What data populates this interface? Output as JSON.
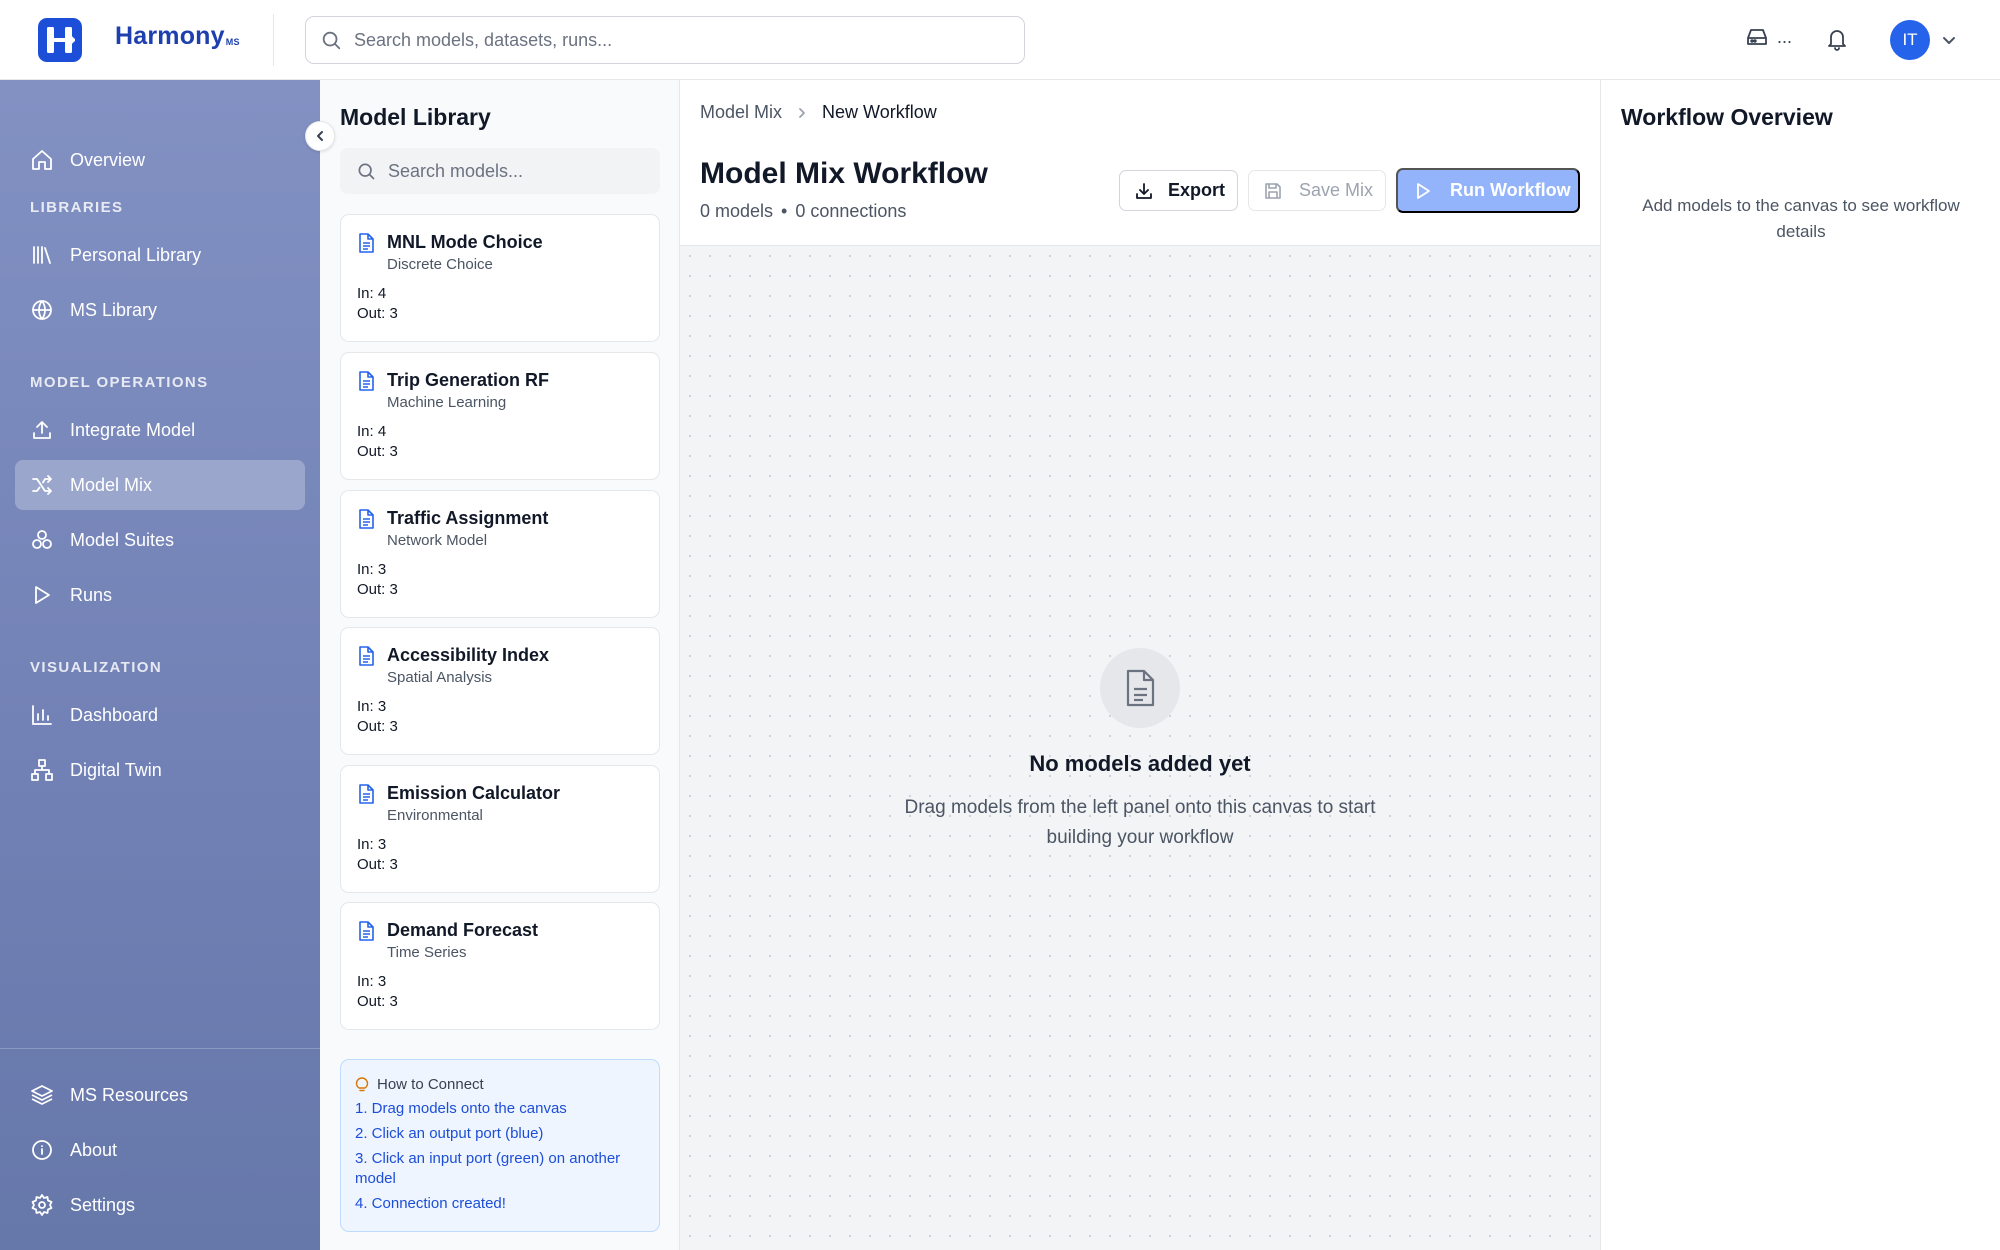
{
  "header": {
    "brand": "Harmony",
    "brand_suffix": "MS",
    "search_placeholder": "Search models, datasets, runs...",
    "storage_label": "...",
    "avatar_initials": "IT"
  },
  "sidebar": {
    "top_item": "Overview",
    "sections": [
      {
        "label": "LIBRARIES",
        "items": [
          "Personal Library",
          "MS Library"
        ]
      },
      {
        "label": "MODEL OPERATIONS",
        "items": [
          "Integrate Model",
          "Model Mix",
          "Model Suites",
          "Runs"
        ]
      },
      {
        "label": "VISUALIZATION",
        "items": [
          "Dashboard",
          "Digital Twin"
        ]
      }
    ],
    "footer_items": [
      "MS Resources",
      "About",
      "Settings"
    ],
    "active_item": "Model Mix"
  },
  "library": {
    "title": "Model Library",
    "search_placeholder": "Search models...",
    "models": [
      {
        "name": "MNL Mode Choice",
        "category": "Discrete Choice",
        "in": "In: 4",
        "out": "Out: 3"
      },
      {
        "name": "Trip Generation RF",
        "category": "Machine Learning",
        "in": "In: 4",
        "out": "Out: 3"
      },
      {
        "name": "Traffic Assignment",
        "category": "Network Model",
        "in": "In: 3",
        "out": "Out: 3"
      },
      {
        "name": "Accessibility Index",
        "category": "Spatial Analysis",
        "in": "In: 3",
        "out": "Out: 3"
      },
      {
        "name": "Emission Calculator",
        "category": "Environmental",
        "in": "In: 3",
        "out": "Out: 3"
      },
      {
        "name": "Demand Forecast",
        "category": "Time Series",
        "in": "In: 3",
        "out": "Out: 3"
      }
    ],
    "howto": {
      "title": "How to Connect",
      "steps": [
        "1. Drag models onto the canvas",
        "2. Click an output port (blue)",
        "3. Click an input port (green) on another model",
        "4. Connection created!"
      ]
    }
  },
  "main": {
    "breadcrumb": [
      "Model Mix",
      "New Workflow"
    ],
    "title": "Model Mix Workflow",
    "models_count": "0 models",
    "separator": "•",
    "connections_count": "0 connections",
    "export_label": "Export",
    "save_label": "Save Mix",
    "run_label": "Run Workflow",
    "empty_title": "No models added yet",
    "empty_subtitle": "Drag models from the left panel onto this canvas to start building your workflow"
  },
  "overview": {
    "title": "Workflow Overview",
    "empty_text": "Add models to the canvas to see workflow details"
  },
  "colors": {
    "brand": "#1d4ed8",
    "run_button_disabled": "#93b4fb",
    "howto_bg": "#eef5fe",
    "howto_text": "#1d4ed8"
  },
  "icons": {
    "logo": "harmony-h-logo",
    "search": "search-icon",
    "storage": "hard-drive-icon",
    "bell": "bell-icon",
    "caret": "chevron-down-icon",
    "collapse": "chevron-left-icon",
    "doc": "document-icon",
    "export": "download-icon",
    "save": "save-icon",
    "run": "play-icon",
    "lightbulb": "lightbulb-icon"
  }
}
